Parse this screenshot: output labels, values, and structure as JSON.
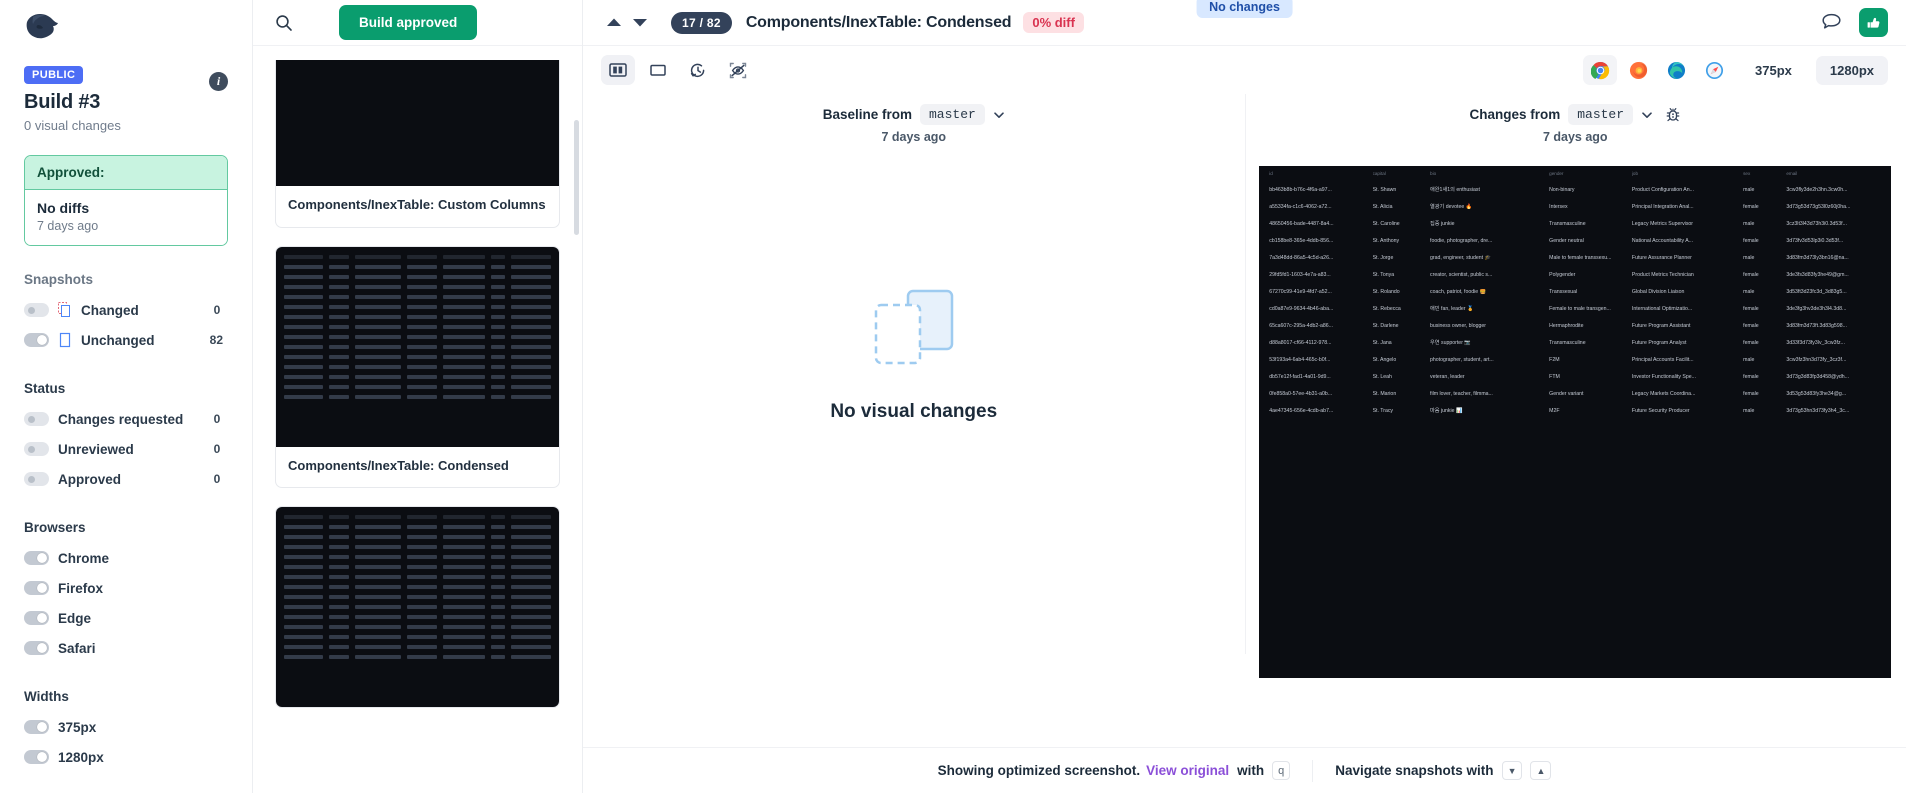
{
  "sidebar": {
    "logo_icon": "lion-head-logo",
    "visibility_badge": "PUBLIC",
    "build_title": "Build #3",
    "build_subtitle": "0 visual changes",
    "info_icon": "info-icon",
    "approved_card": {
      "header": "Approved:",
      "title": "No diffs",
      "timestamp": "7 days ago"
    },
    "snapshots_section": {
      "title": "Snapshots",
      "items": [
        {
          "label": "Changed",
          "count": "0",
          "toggle": "off",
          "icon": "changed-snapshot-icon"
        },
        {
          "label": "Unchanged",
          "count": "82",
          "toggle": "on",
          "icon": "unchanged-snapshot-icon"
        }
      ]
    },
    "status_section": {
      "title": "Status",
      "items": [
        {
          "label": "Changes requested",
          "count": "0",
          "toggle": "off"
        },
        {
          "label": "Unreviewed",
          "count": "0",
          "toggle": "off"
        },
        {
          "label": "Approved",
          "count": "0",
          "toggle": "off"
        }
      ]
    },
    "browsers_section": {
      "title": "Browsers",
      "items": [
        {
          "label": "Chrome",
          "toggle": "on"
        },
        {
          "label": "Firefox",
          "toggle": "on"
        },
        {
          "label": "Edge",
          "toggle": "on"
        },
        {
          "label": "Safari",
          "toggle": "on"
        }
      ]
    },
    "widths_section": {
      "title": "Widths",
      "items": [
        {
          "label": "375px",
          "toggle": "on"
        },
        {
          "label": "1280px",
          "toggle": "on"
        }
      ]
    }
  },
  "snaplist": {
    "search_icon": "search-icon",
    "approve_button": "Build approved",
    "cards": [
      {
        "label": "Components/InexTable: Custom Columns"
      },
      {
        "label": "Components/InexTable: Condensed"
      },
      {
        "label": ""
      }
    ]
  },
  "header": {
    "prev_icon": "chevron-up-icon",
    "next_icon": "chevron-down-icon",
    "counter": "17 / 82",
    "title": "Components/InexTable: Condensed",
    "diff_badge": "0% diff",
    "no_changes_badge": "No changes",
    "comment_icon": "comment-icon",
    "approve_icon": "thumbs-up-icon"
  },
  "toolbar": {
    "buttons": [
      {
        "icon": "split-view-icon",
        "active": true
      },
      {
        "icon": "single-view-icon",
        "active": false
      },
      {
        "icon": "history-icon",
        "active": false
      },
      {
        "icon": "hide-diff-overlay-icon",
        "active": false
      }
    ],
    "browsers": [
      {
        "icon": "chrome-icon",
        "active": true
      },
      {
        "icon": "firefox-icon",
        "active": false
      },
      {
        "icon": "edge-icon",
        "active": false
      },
      {
        "icon": "safari-icon",
        "active": false
      }
    ],
    "widths": [
      {
        "label": "375px",
        "active": false
      },
      {
        "label": "1280px",
        "active": true
      }
    ]
  },
  "compare": {
    "baseline": {
      "label": "Baseline from",
      "branch": "master",
      "timestamp": "7 days ago",
      "chevron_icon": "chevron-down-icon"
    },
    "changes": {
      "label": "Changes from",
      "branch": "master",
      "timestamp": "7 days ago",
      "chevron_icon": "chevron-down-icon",
      "settings_icon": "bug-settings-icon"
    },
    "empty_state": {
      "icon": "no-visual-changes-icon",
      "title": "No visual changes"
    }
  },
  "screenshot_table": {
    "headers": [
      "id",
      "capital",
      "bio",
      "gender",
      "job",
      "sex",
      "email"
    ],
    "rows": [
      [
        "bb463b8b-b76c-4f6a-a97...",
        "St. Shawn",
        "애완1새1의 enthusiast",
        "Non-binary",
        "Product Configuration An...",
        "male",
        "3cw3fly3de2h3hn.3cw0h..."
      ],
      [
        "a55334fa-c1c6-4062-a72...",
        "St. Alicia",
        "열광기 devotee 🔥",
        "Intersex",
        "Principal Integration Anal...",
        "female",
        "3d73g53d73g53l0z60j0ha..."
      ],
      [
        "48650456-bade-4487-8a4...",
        "St. Caroline",
        "집중 junkie",
        "Transmasculine",
        "Legacy Metrics Supervisor",
        "male",
        "3cz3lt3l43d73h3i0.3d53f..."
      ],
      [
        "cb158be8-365e-4ddb-856...",
        "St. Anthony",
        "foodie, photographer, dre...",
        "Gender neutral",
        "National Accountability A...",
        "female",
        "3d73fv3d53lp3i0.3d53f..."
      ],
      [
        "7a3d48dd-86a5-4c5d-a26...",
        "St. Jorge",
        "grad, engineer, student 🎓",
        "Male to female transsexu...",
        "Future Assurance Planner",
        "male",
        "3d83fm3d73ly3bn16@na..."
      ],
      [
        "29fd5fd1-1603-4e7a-a83...",
        "St. Tonya",
        "creator, scientist, public s...",
        "Polygender",
        "Product Metrics Technician",
        "female",
        "3de3fs3d83fy3he49@gm..."
      ],
      [
        "67270c99-41e9-4fd7-a52...",
        "St. Rolando",
        "coach, patriot, foodie 🍔",
        "Transsexual",
        "Global Division Liaison",
        "male",
        "3d53ft3d23fc3d_3d83g5..."
      ],
      [
        "cd0a87e9-9634-4b46-aba...",
        "St. Rebecca",
        "애민 fan, leader 🏅",
        "Female to male transgen...",
        "International Optimizatio...",
        "female",
        "3de3fg3hv3de3h3l4.3d8..."
      ],
      [
        "65ca607c-295a-4db2-a86...",
        "St. Darlene",
        "business owner, blogger",
        "Hermaphrodite",
        "Future Program Assistant",
        "female",
        "3d83fm3d73ft.3d83g598..."
      ],
      [
        "d88a8017-cf66-4112-978...",
        "St. Jana",
        "우연 supporter 📷",
        "Transmasculine",
        "Future Program Analyst",
        "female",
        "3d33f3d73fy3lv_3cw3fz..."
      ],
      [
        "53f193a4-6ab4-465c-b0f...",
        "St. Angelo",
        "photographer, student, art...",
        "F2M",
        "Principal Accounts Facilit...",
        "male",
        "3cw3fz3hn3d73fy_3cz3f..."
      ],
      [
        "db57e12f-fad1-4a01-9d9...",
        "St. Leah",
        "veteran, leader",
        "FTM",
        "Investor Functionality Spe...",
        "female",
        "3d73g3d83fp3d458@ydh..."
      ],
      [
        "0fe858a0-57ee-4b31-a0b...",
        "St. Marion",
        "film lover, teacher, filmma...",
        "Gender variant",
        "Legacy Markets Coordina...",
        "female",
        "3d53g53d83fy3he34@g..."
      ],
      [
        "4ae47345-656e-4cdb-ab7...",
        "St. Tracy",
        "마음 junkie 📊",
        "M2F",
        "Future Security Producer",
        "male",
        "3d73g53hn3d73fy3h4_3c..."
      ]
    ]
  },
  "footer": {
    "text": "Showing optimized screenshot.",
    "link": "View original",
    "with_text": "with",
    "key": "q",
    "navigate_text": "Navigate snapshots with",
    "key_down": "▼",
    "key_up": "▲"
  }
}
